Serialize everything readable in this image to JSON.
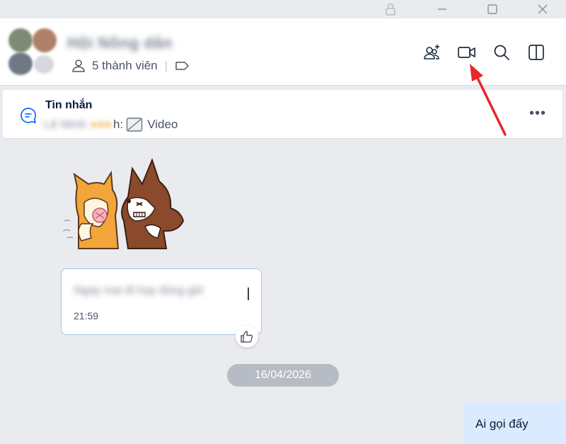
{
  "window": {
    "lock_icon": "lock-icon",
    "minimize_icon": "minimize-icon",
    "maximize_icon": "maximize-icon",
    "close_icon": "close-icon"
  },
  "header": {
    "group_name": "Hội Nông dân",
    "member_count": "5 thành viên",
    "icons": [
      "add-member-icon",
      "video-call-icon",
      "search-icon",
      "side-panel-icon"
    ]
  },
  "pinned": {
    "title": "Tin nhắn",
    "sender_blurred": "Lê Minh",
    "sender_suffix": "h:",
    "attachment_label": "Video"
  },
  "messages": {
    "incoming_text": "Ngày mai đi họp đúng giờ",
    "incoming_time": "21:59",
    "date_separator": "16/04/2026",
    "outgoing_text": "Ai gọi đấy"
  },
  "colors": {
    "background": "#e9ebef",
    "accent": "#0068ff",
    "bubble_border": "#a9c3ee",
    "outgoing_bubble": "#dbebff",
    "annotation_arrow": "#e8252b"
  }
}
